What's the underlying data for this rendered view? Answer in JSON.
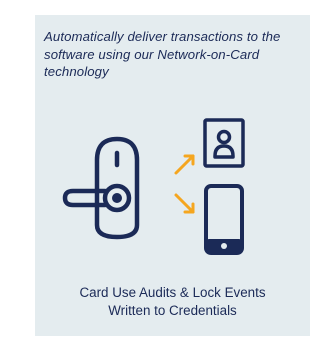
{
  "headline": {
    "text": "Automatically deliver transactions to the software using our Network-on-Card technology",
    "color": "#1b2a57"
  },
  "illustration": {
    "icons": [
      "door-lock-icon",
      "id-badge-icon",
      "smartphone-icon",
      "arrow-up-right-icon",
      "arrow-down-right-icon"
    ],
    "icon_color": "#1b2a57",
    "arrow_color": "#f5a61f"
  },
  "caption": {
    "line1": "Card Use Audits & Lock Events",
    "line2": "Written to Credentials"
  },
  "colors": {
    "card_background": "#e4ecef",
    "page_background": "#ffffff"
  }
}
